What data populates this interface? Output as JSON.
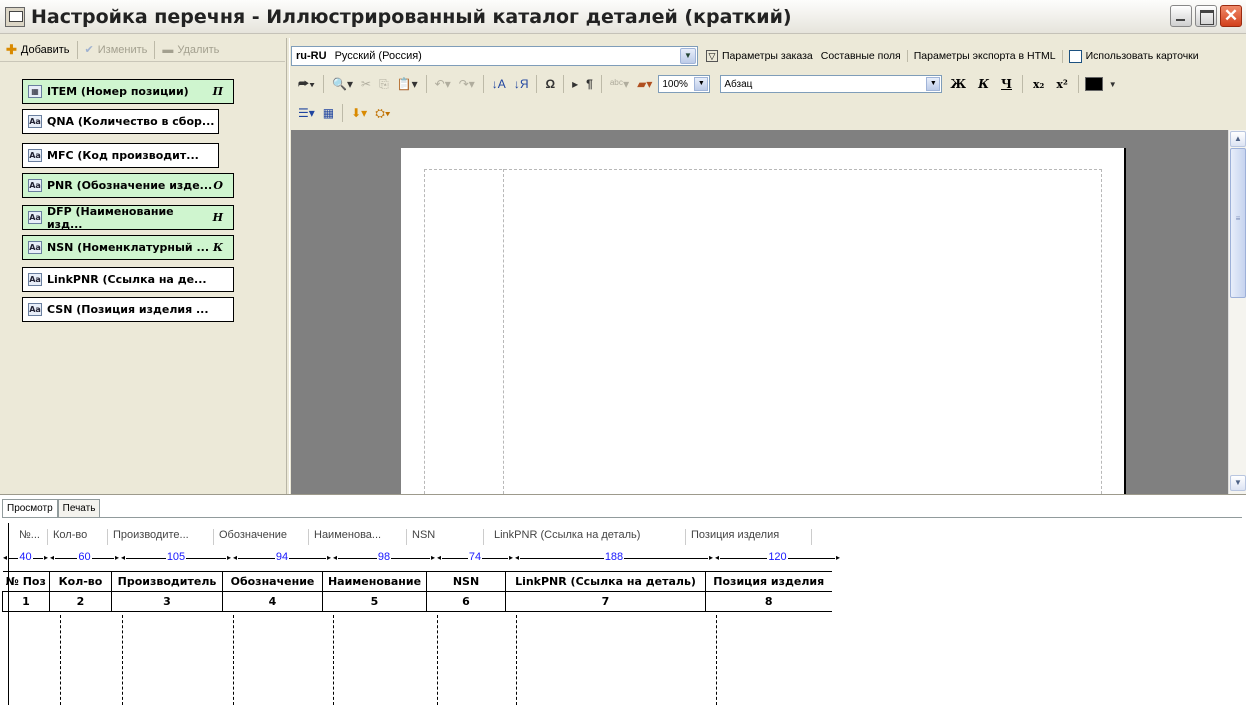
{
  "window": {
    "title": "Настройка перечня - Иллюстрированный каталог деталей (краткий)"
  },
  "left_toolbar": {
    "add": "Добавить",
    "edit": "Изменить",
    "delete": "Удалить"
  },
  "fields": [
    {
      "label": "ITEM (Номер позиции)",
      "mark": "П",
      "green": true
    },
    {
      "label": "QNA (Количество в сбор...",
      "mark": "",
      "green": false
    },
    {
      "label": "MFC (Код производит...",
      "mark": "",
      "green": false
    },
    {
      "label": "PNR (Обозначение изде...",
      "mark": "О",
      "green": true
    },
    {
      "label": "DFP (Наименование изд...",
      "mark": "Н",
      "green": true
    },
    {
      "label": "NSN (Номенклатурный ...",
      "mark": "К",
      "green": true
    },
    {
      "label": "LinkPNR (Ссылка на де...",
      "mark": "",
      "green": false
    },
    {
      "label": "CSN  (Позиция изделия ...",
      "mark": "",
      "green": false
    }
  ],
  "lang_bar": {
    "code": "ru-RU",
    "name": "Русский (Россия)",
    "order_params": "Параметры заказа",
    "composite_fields": "Составные поля",
    "export_html": "Параметры экспорта в HTML",
    "use_cards": "Использовать карточки"
  },
  "format_bar": {
    "zoom": "100%",
    "style": "Абзац",
    "bold": "Ж",
    "italic": "К",
    "underline": "Ч",
    "sub": "x₂",
    "sup": "x²"
  },
  "bottom_tabs": [
    "Просмотр",
    "Печать"
  ],
  "preview": {
    "headers": [
      "№...",
      "Кол-во",
      "Производите...",
      "Обозначение",
      "Наименова...",
      "NSN",
      "LinkPNR (Ссылка на деталь)",
      "Позиция изделия"
    ],
    "widths": [
      "40",
      "60",
      "105",
      "94",
      "98",
      "74",
      "188",
      "120"
    ],
    "columns": [
      "№ Поз",
      "Кол-во",
      "Производитель",
      "Обозначение",
      "Наименование",
      "NSN",
      "LinkPNR (Ссылка на деталь)",
      "Позиция изделия"
    ],
    "numbers": [
      "1",
      "2",
      "3",
      "4",
      "5",
      "6",
      "7",
      "8"
    ]
  }
}
